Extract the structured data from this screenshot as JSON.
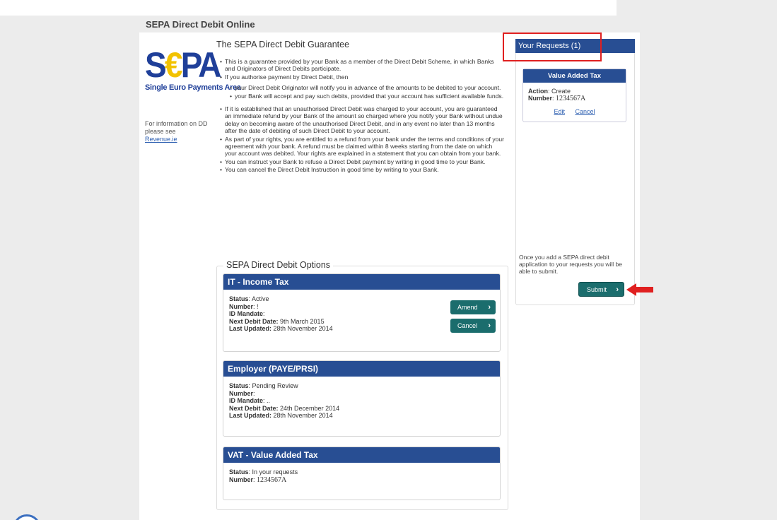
{
  "app": {
    "title": "SEPA Direct Debit Online"
  },
  "logo": {
    "letters_left": "S",
    "letters_euro": "€",
    "letters_right": "PA",
    "subtitle": "Single Euro Payments Area"
  },
  "info": {
    "text": "For information on DD please see",
    "link": "Revenue.ie"
  },
  "guarantee": {
    "title": "The SEPA Direct Debit Guarantee",
    "items": [
      "This is a guarantee provided by your Bank as a member of the Direct Debit Scheme, in which Banks and Originators of Direct Debits participate.",
      "If you authorise payment by Direct Debit, then"
    ],
    "subitems": [
      "your Direct Debit Originator will notify you in advance of the amounts to be debited to your account.",
      "your Bank will accept and pay such debits, provided that your account has sufficient available funds."
    ],
    "items2": [
      "If it is established that an unauthorised Direct Debit was charged to your account, you are guaranteed an immediate refund by your Bank of the amount so charged where you notify your Bank without undue delay on becoming aware of the unauthorised Direct Debit, and in any event no later than 13 months after the date of debiting of such Direct Debit to your account.",
      "As part of your rights, you are entitled to a refund from your bank under the terms and conditions of your agreement with your bank. A refund must be claimed within 8 weeks starting from the date on which your account was debited. Your rights are explained in a statement that you can obtain from your bank.",
      "You can instruct your Bank to refuse a Direct Debit payment by writing in good time to your Bank.",
      "You can cancel the Direct Debit Instruction in good time by writing to your Bank."
    ]
  },
  "options": {
    "legend": "SEPA Direct Debit Options",
    "cards": [
      {
        "title": "IT - Income Tax",
        "status_label": "Status",
        "status": "Active",
        "number_label": "Number",
        "number": "!",
        "mandate_label": "ID Mandate",
        "mandate": "",
        "next_label": "Next Debit Date:",
        "next": "9th March 2015",
        "updated_label": "Last Updated:",
        "updated": "28th November 2014",
        "amend": "Amend",
        "cancel": "Cancel"
      },
      {
        "title": "Employer (PAYE/PRSI)",
        "status_label": "Status",
        "status": "Pending Review",
        "number_label": "Number",
        "number": "",
        "mandate_label": "ID Mandate",
        "mandate": "..",
        "next_label": "Next Debit Date:",
        "next": "24th December 2014",
        "updated_label": "Last Updated:",
        "updated": "28th November 2014"
      },
      {
        "title": "VAT - Value Added Tax",
        "status_label": "Status",
        "status": "In your requests",
        "number_label": "Number",
        "number": "1234567A"
      }
    ]
  },
  "requests": {
    "title": "Your Requests (1)",
    "card": {
      "title": "Value Added Tax",
      "action_label": "Action",
      "action": "Create",
      "number_label": "Number",
      "number": "1234567A",
      "edit": "Edit",
      "cancel": "Cancel"
    },
    "note": "Once you add a SEPA direct debit application to your requests you will be able to submit.",
    "submit": "Submit"
  },
  "colors": {
    "header_blue": "#284e93",
    "teal_button": "#1b6d6d",
    "annotation_red": "#e02020"
  }
}
